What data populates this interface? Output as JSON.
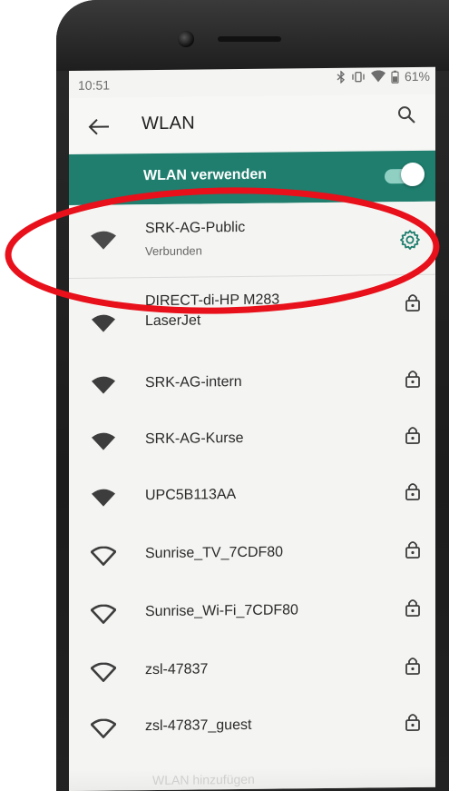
{
  "status_bar": {
    "time": "10:51",
    "battery": "61%",
    "icons": [
      "bluetooth-icon",
      "vibrate-icon",
      "wifi-signal-icon",
      "battery-icon"
    ]
  },
  "app_bar": {
    "title": "WLAN",
    "back_icon": "arrow-left-icon",
    "search_icon": "search-icon"
  },
  "master_switch": {
    "label": "WLAN verwenden",
    "enabled": true
  },
  "connected_network": {
    "name": "SRK-AG-Public",
    "status": "Verbunden",
    "settings_icon": "gear-icon"
  },
  "networks": [
    {
      "name": "DIRECT-di-HP M283",
      "name2": "LaserJet",
      "secured": true,
      "signal": "full"
    },
    {
      "name": "SRK-AG-intern",
      "secured": true,
      "signal": "full"
    },
    {
      "name": "SRK-AG-Kurse",
      "secured": true,
      "signal": "full"
    },
    {
      "name": "UPC5B113AA",
      "secured": true,
      "signal": "full"
    },
    {
      "name": "Sunrise_TV_7CDF80",
      "secured": true,
      "signal": "outline"
    },
    {
      "name": "Sunrise_Wi-Fi_7CDF80",
      "secured": true,
      "signal": "outline"
    },
    {
      "name": "zsl-47837",
      "secured": true,
      "signal": "outline"
    },
    {
      "name": "zsl-47837_guest",
      "secured": true,
      "signal": "outline"
    }
  ],
  "footer": {
    "partial_label": "WLAN hinzufügen"
  },
  "colors": {
    "accent": "#1f7e6e",
    "annotation": "#e8101a"
  }
}
